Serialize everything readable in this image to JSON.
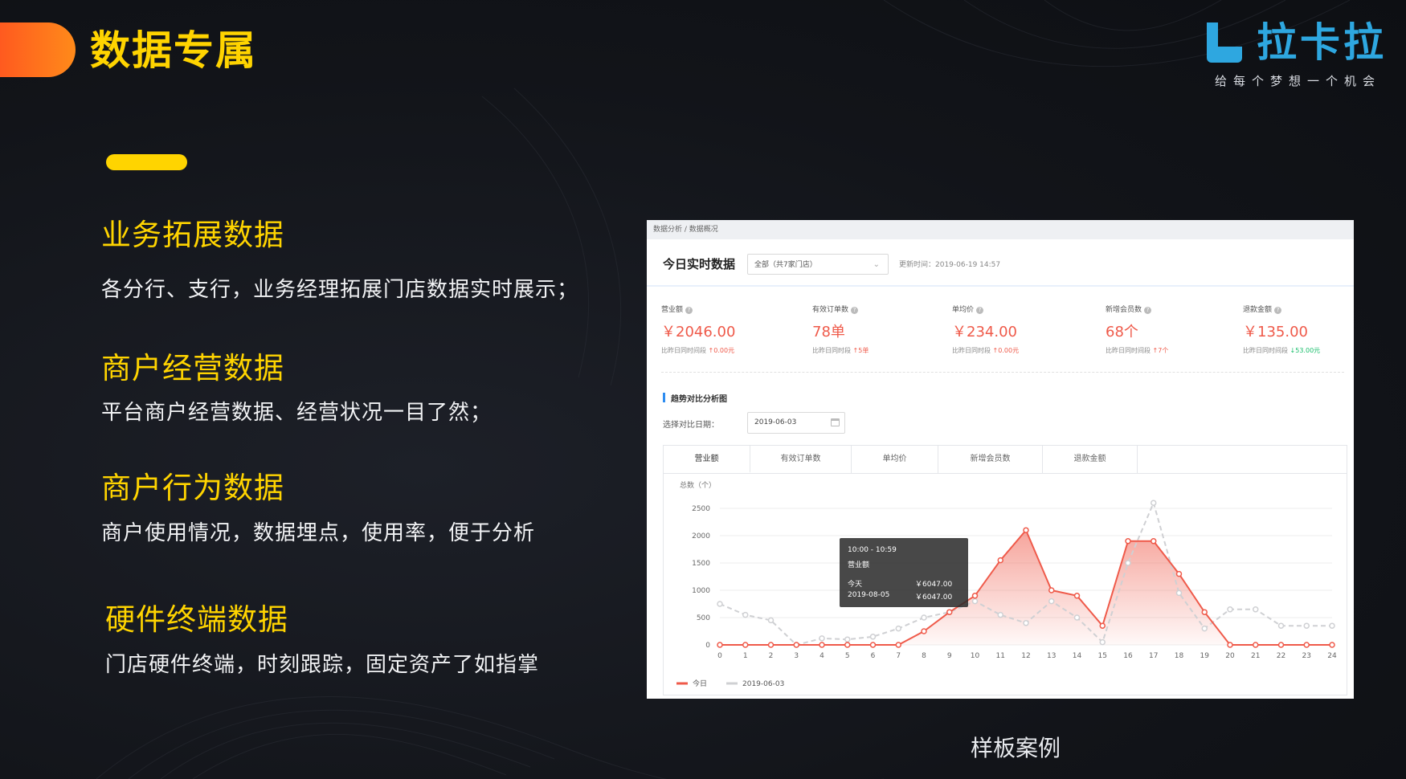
{
  "slide": {
    "title": "数据专属",
    "caption": "样板案例",
    "colors": {
      "accent_yellow": "#ffd400",
      "accent_orange": "#ff6a1f",
      "brand_blue": "#2ea7e0"
    }
  },
  "logo": {
    "name": "拉卡拉",
    "slogan": "给每个梦想一个机会",
    "icon": "lakala-logo-mark"
  },
  "sections": [
    {
      "title": "业务拓展数据",
      "desc": "各分行、支行，业务经理拓展门店数据实时展示；"
    },
    {
      "title": "商户经营数据",
      "desc": "平台商户经营数据、经营状况一目了然；"
    },
    {
      "title": "商户行为数据",
      "desc": "商户使用情况，数据埋点，使用率，便于分析"
    },
    {
      "title": "硬件终端数据",
      "desc": "门店硬件终端，时刻跟踪，固定资产了如指掌"
    }
  ],
  "screenshot": {
    "breadcrumb": "数据分析 / 数据概况",
    "realtime_title": "今日实时数据",
    "store_select": "全部（共7家门店）",
    "update_time": "更新时间：2019-06-19 14:57",
    "metrics": [
      {
        "label": "营业额",
        "value": "￥2046.00",
        "compare": "比昨日同时间段",
        "delta": "↑0.00元",
        "dir": "up"
      },
      {
        "label": "有效订单数",
        "value": "78单",
        "compare": "比昨日同时段",
        "delta": "↑5单",
        "dir": "up"
      },
      {
        "label": "单均价",
        "value": "￥234.00",
        "compare": "比昨日同时段",
        "delta": "↑0.00元",
        "dir": "up"
      },
      {
        "label": "新增会员数",
        "value": "68个",
        "compare": "比昨日同时间段",
        "delta": "↑7个",
        "dir": "up"
      },
      {
        "label": "退款金额",
        "value": "￥135.00",
        "compare": "比昨日同时间段",
        "delta": "↓53.00元",
        "dir": "down"
      }
    ],
    "trend_title": "趋势对比分析图",
    "date_label": "选择对比日期：",
    "date_value": "2019-06-03",
    "tabs": [
      "营业额",
      "有效订单数",
      "单均价",
      "新增会员数",
      "退款金额"
    ],
    "tooltip": {
      "time": "10:00 - 10:59",
      "metric": "营业额",
      "rows": [
        {
          "label": "今天",
          "value": "￥6047.00"
        },
        {
          "label": "2019-08-05",
          "value": "￥6047.00"
        }
      ]
    }
  },
  "chart_data": {
    "type": "line",
    "ylabel": "总数（个）",
    "x": [
      0,
      1,
      2,
      3,
      4,
      5,
      6,
      7,
      8,
      9,
      10,
      11,
      12,
      13,
      14,
      15,
      16,
      17,
      18,
      19,
      20,
      21,
      22,
      23,
      24
    ],
    "ylim": [
      0,
      2500
    ],
    "yticks": [
      0,
      500,
      1000,
      1500,
      2000,
      2500
    ],
    "series": [
      {
        "name": "今日",
        "color": "#ef5a4a",
        "style": "solid",
        "values": [
          0,
          0,
          0,
          0,
          0,
          0,
          0,
          0,
          250,
          600,
          900,
          1550,
          2100,
          1000,
          900,
          350,
          1900,
          1900,
          1300,
          600,
          0,
          0,
          0,
          0,
          0
        ]
      },
      {
        "name": "2019-06-03",
        "color": "#cfd0d3",
        "style": "dashed",
        "values": [
          750,
          550,
          450,
          0,
          120,
          100,
          150,
          300,
          500,
          600,
          800,
          550,
          400,
          800,
          500,
          50,
          1500,
          2600,
          950,
          300,
          650,
          650,
          350,
          350,
          350
        ]
      }
    ],
    "legend": "bottom-left"
  }
}
